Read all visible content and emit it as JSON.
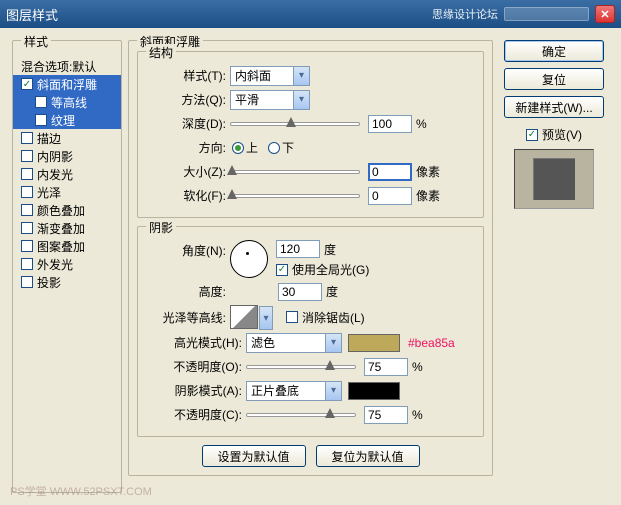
{
  "titlebar": {
    "title": "图层样式",
    "forum": "思缘设计论坛"
  },
  "left": {
    "group_label": "样式",
    "blend_item": "混合选项:默认",
    "items": [
      {
        "label": "斜面和浮雕",
        "checked": true,
        "selected": true,
        "sub": false
      },
      {
        "label": "等高线",
        "checked": false,
        "selected": true,
        "sub": true
      },
      {
        "label": "纹理",
        "checked": false,
        "selected": true,
        "sub": true
      },
      {
        "label": "描边",
        "checked": false,
        "selected": false,
        "sub": false
      },
      {
        "label": "内阴影",
        "checked": false,
        "selected": false,
        "sub": false
      },
      {
        "label": "内发光",
        "checked": false,
        "selected": false,
        "sub": false
      },
      {
        "label": "光泽",
        "checked": false,
        "selected": false,
        "sub": false
      },
      {
        "label": "颜色叠加",
        "checked": false,
        "selected": false,
        "sub": false
      },
      {
        "label": "渐变叠加",
        "checked": false,
        "selected": false,
        "sub": false
      },
      {
        "label": "图案叠加",
        "checked": false,
        "selected": false,
        "sub": false
      },
      {
        "label": "外发光",
        "checked": false,
        "selected": false,
        "sub": false
      },
      {
        "label": "投影",
        "checked": false,
        "selected": false,
        "sub": false
      }
    ]
  },
  "mid": {
    "panel_title": "斜面和浮雕",
    "structure": {
      "group_label": "结构",
      "style_label": "样式(T):",
      "style_value": "内斜面",
      "tech_label": "方法(Q):",
      "tech_value": "平滑",
      "depth_label": "深度(D):",
      "depth_value": "100",
      "depth_unit": "%",
      "dir_label": "方向:",
      "dir_up": "上",
      "dir_down": "下",
      "size_label": "大小(Z):",
      "size_value": "0",
      "size_unit": "像素",
      "soft_label": "软化(F):",
      "soft_value": "0",
      "soft_unit": "像素"
    },
    "shading": {
      "group_label": "阴影",
      "angle_label": "角度(N):",
      "angle_value": "120",
      "angle_unit": "度",
      "global_label": "使用全局光(G)",
      "alt_label": "高度:",
      "alt_value": "30",
      "alt_unit": "度",
      "gloss_label": "光泽等高线:",
      "aa_label": "消除锯齿(L)",
      "hi_mode_label": "高光模式(H):",
      "hi_mode_value": "滤色",
      "hi_color": "#bea85a",
      "annotation": "#bea85a",
      "hi_op_label": "不透明度(O):",
      "hi_op_value": "75",
      "hi_op_unit": "%",
      "sh_mode_label": "阴影模式(A):",
      "sh_mode_value": "正片叠底",
      "sh_color": "#000000",
      "sh_op_label": "不透明度(C):",
      "sh_op_value": "75",
      "sh_op_unit": "%"
    },
    "bottom": {
      "make_default": "设置为默认值",
      "reset_default": "复位为默认值"
    }
  },
  "right": {
    "ok": "确定",
    "cancel": "复位",
    "new_style": "新建样式(W)...",
    "preview_label": "预览(V)"
  },
  "watermark": "PS学堂  WWW.52PSXT.COM"
}
